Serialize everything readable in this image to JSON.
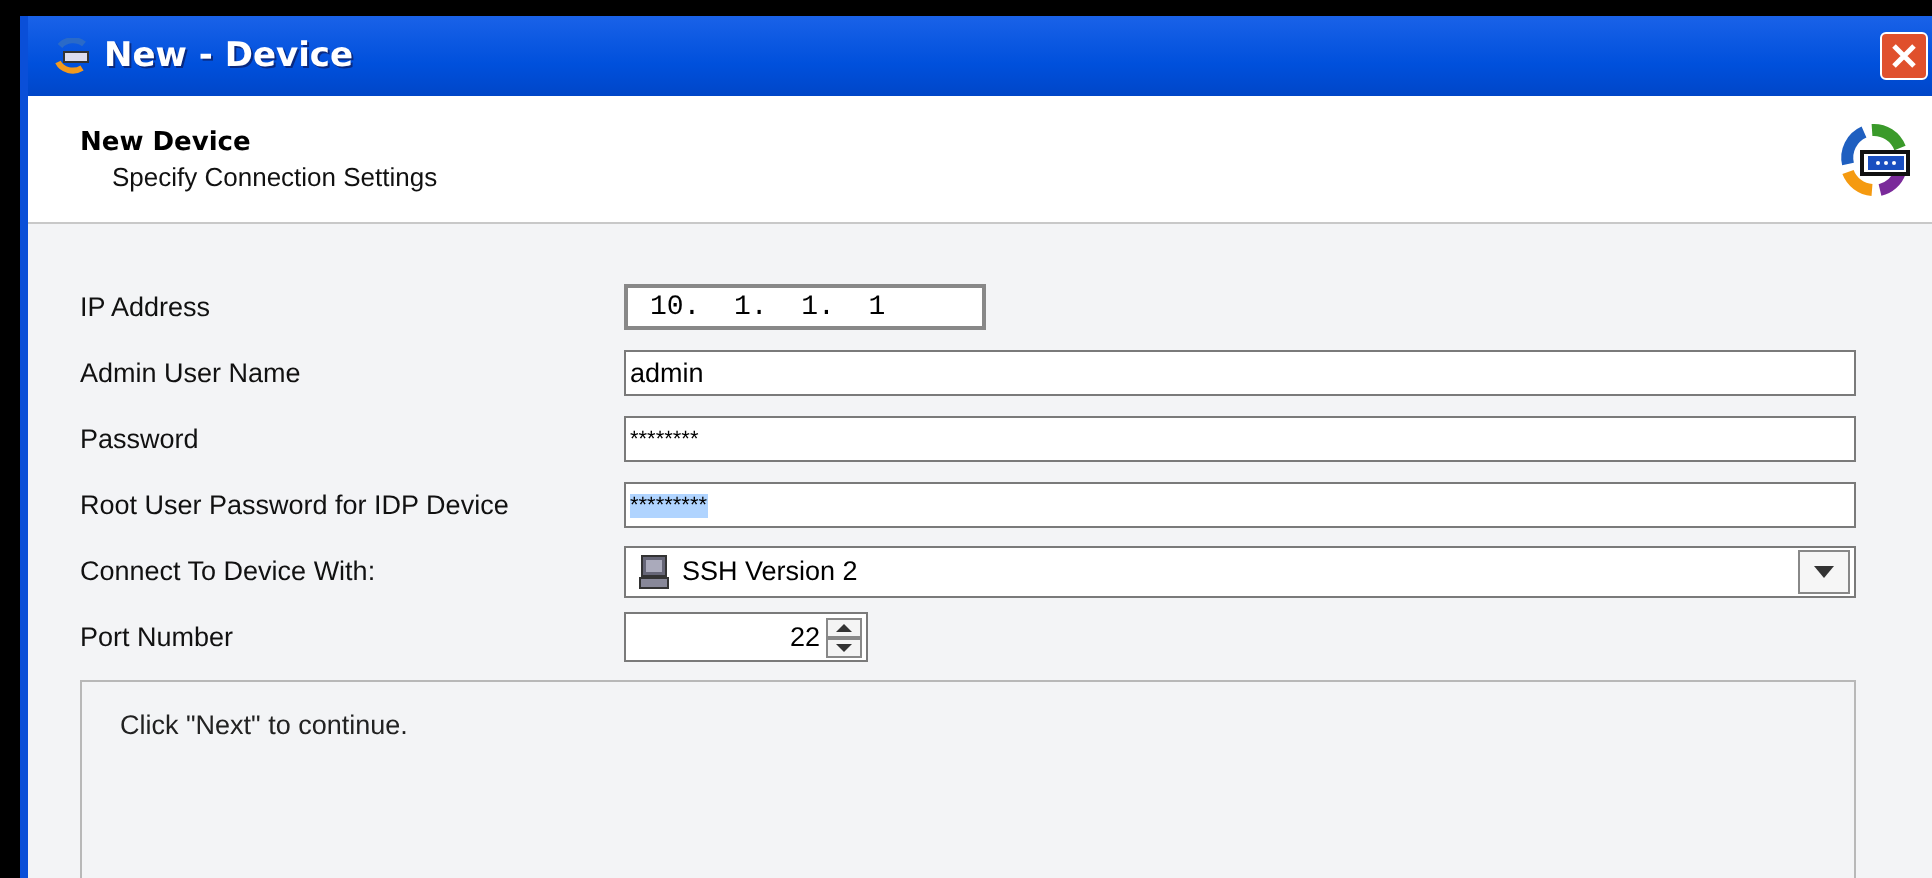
{
  "window": {
    "title": "New - Device"
  },
  "header": {
    "title": "New Device",
    "subtitle": "Specify Connection Settings"
  },
  "fields": [
    {
      "label": "IP Address",
      "kind": "ip",
      "value": "10.  1.  1.  1"
    },
    {
      "label": "Admin User Name",
      "kind": "text",
      "value": "admin"
    },
    {
      "label": "Password",
      "kind": "password",
      "value": "********"
    },
    {
      "label": "Root User Password for IDP Device",
      "kind": "password",
      "value": "*********",
      "highlighted": true
    },
    {
      "label": "Connect To Device With:",
      "kind": "dropdown",
      "value": "SSH Version 2"
    },
    {
      "label": "Port Number",
      "kind": "spinner",
      "value": "22"
    }
  ],
  "message": "Click \"Next\" to continue."
}
